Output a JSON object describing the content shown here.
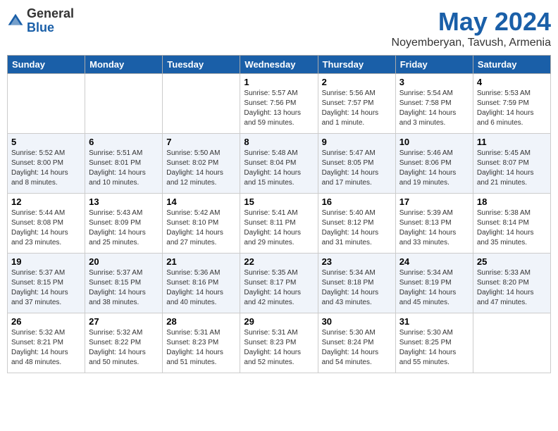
{
  "header": {
    "logo_general": "General",
    "logo_blue": "Blue",
    "month": "May 2024",
    "location": "Noyemberyan, Tavush, Armenia"
  },
  "days_of_week": [
    "Sunday",
    "Monday",
    "Tuesday",
    "Wednesday",
    "Thursday",
    "Friday",
    "Saturday"
  ],
  "weeks": [
    [
      {
        "day": "",
        "info": ""
      },
      {
        "day": "",
        "info": ""
      },
      {
        "day": "",
        "info": ""
      },
      {
        "day": "1",
        "info": "Sunrise: 5:57 AM\nSunset: 7:56 PM\nDaylight: 13 hours\nand 59 minutes."
      },
      {
        "day": "2",
        "info": "Sunrise: 5:56 AM\nSunset: 7:57 PM\nDaylight: 14 hours\nand 1 minute."
      },
      {
        "day": "3",
        "info": "Sunrise: 5:54 AM\nSunset: 7:58 PM\nDaylight: 14 hours\nand 3 minutes."
      },
      {
        "day": "4",
        "info": "Sunrise: 5:53 AM\nSunset: 7:59 PM\nDaylight: 14 hours\nand 6 minutes."
      }
    ],
    [
      {
        "day": "5",
        "info": "Sunrise: 5:52 AM\nSunset: 8:00 PM\nDaylight: 14 hours\nand 8 minutes."
      },
      {
        "day": "6",
        "info": "Sunrise: 5:51 AM\nSunset: 8:01 PM\nDaylight: 14 hours\nand 10 minutes."
      },
      {
        "day": "7",
        "info": "Sunrise: 5:50 AM\nSunset: 8:02 PM\nDaylight: 14 hours\nand 12 minutes."
      },
      {
        "day": "8",
        "info": "Sunrise: 5:48 AM\nSunset: 8:04 PM\nDaylight: 14 hours\nand 15 minutes."
      },
      {
        "day": "9",
        "info": "Sunrise: 5:47 AM\nSunset: 8:05 PM\nDaylight: 14 hours\nand 17 minutes."
      },
      {
        "day": "10",
        "info": "Sunrise: 5:46 AM\nSunset: 8:06 PM\nDaylight: 14 hours\nand 19 minutes."
      },
      {
        "day": "11",
        "info": "Sunrise: 5:45 AM\nSunset: 8:07 PM\nDaylight: 14 hours\nand 21 minutes."
      }
    ],
    [
      {
        "day": "12",
        "info": "Sunrise: 5:44 AM\nSunset: 8:08 PM\nDaylight: 14 hours\nand 23 minutes."
      },
      {
        "day": "13",
        "info": "Sunrise: 5:43 AM\nSunset: 8:09 PM\nDaylight: 14 hours\nand 25 minutes."
      },
      {
        "day": "14",
        "info": "Sunrise: 5:42 AM\nSunset: 8:10 PM\nDaylight: 14 hours\nand 27 minutes."
      },
      {
        "day": "15",
        "info": "Sunrise: 5:41 AM\nSunset: 8:11 PM\nDaylight: 14 hours\nand 29 minutes."
      },
      {
        "day": "16",
        "info": "Sunrise: 5:40 AM\nSunset: 8:12 PM\nDaylight: 14 hours\nand 31 minutes."
      },
      {
        "day": "17",
        "info": "Sunrise: 5:39 AM\nSunset: 8:13 PM\nDaylight: 14 hours\nand 33 minutes."
      },
      {
        "day": "18",
        "info": "Sunrise: 5:38 AM\nSunset: 8:14 PM\nDaylight: 14 hours\nand 35 minutes."
      }
    ],
    [
      {
        "day": "19",
        "info": "Sunrise: 5:37 AM\nSunset: 8:15 PM\nDaylight: 14 hours\nand 37 minutes."
      },
      {
        "day": "20",
        "info": "Sunrise: 5:37 AM\nSunset: 8:15 PM\nDaylight: 14 hours\nand 38 minutes."
      },
      {
        "day": "21",
        "info": "Sunrise: 5:36 AM\nSunset: 8:16 PM\nDaylight: 14 hours\nand 40 minutes."
      },
      {
        "day": "22",
        "info": "Sunrise: 5:35 AM\nSunset: 8:17 PM\nDaylight: 14 hours\nand 42 minutes."
      },
      {
        "day": "23",
        "info": "Sunrise: 5:34 AM\nSunset: 8:18 PM\nDaylight: 14 hours\nand 43 minutes."
      },
      {
        "day": "24",
        "info": "Sunrise: 5:34 AM\nSunset: 8:19 PM\nDaylight: 14 hours\nand 45 minutes."
      },
      {
        "day": "25",
        "info": "Sunrise: 5:33 AM\nSunset: 8:20 PM\nDaylight: 14 hours\nand 47 minutes."
      }
    ],
    [
      {
        "day": "26",
        "info": "Sunrise: 5:32 AM\nSunset: 8:21 PM\nDaylight: 14 hours\nand 48 minutes."
      },
      {
        "day": "27",
        "info": "Sunrise: 5:32 AM\nSunset: 8:22 PM\nDaylight: 14 hours\nand 50 minutes."
      },
      {
        "day": "28",
        "info": "Sunrise: 5:31 AM\nSunset: 8:23 PM\nDaylight: 14 hours\nand 51 minutes."
      },
      {
        "day": "29",
        "info": "Sunrise: 5:31 AM\nSunset: 8:23 PM\nDaylight: 14 hours\nand 52 minutes."
      },
      {
        "day": "30",
        "info": "Sunrise: 5:30 AM\nSunset: 8:24 PM\nDaylight: 14 hours\nand 54 minutes."
      },
      {
        "day": "31",
        "info": "Sunrise: 5:30 AM\nSunset: 8:25 PM\nDaylight: 14 hours\nand 55 minutes."
      },
      {
        "day": "",
        "info": ""
      }
    ]
  ]
}
